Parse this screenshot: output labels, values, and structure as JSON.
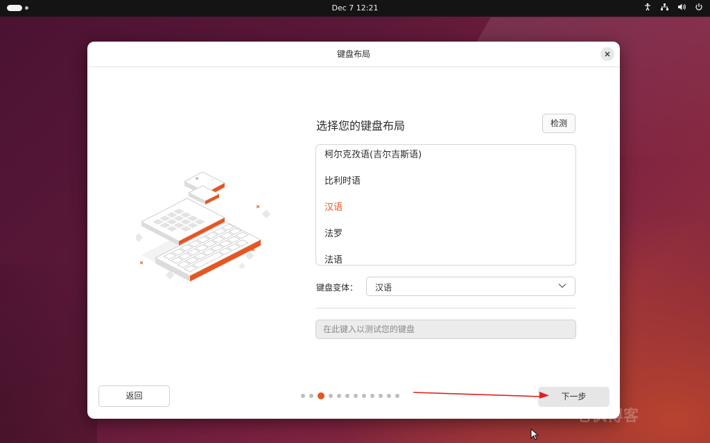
{
  "topbar": {
    "clock": "Dec 7  12:21",
    "tray_icons": [
      "accessibility-icon",
      "network-icon",
      "volume-icon",
      "power-icon"
    ]
  },
  "dialog": {
    "title": "键盘布局",
    "section_title": "选择您的键盘布局",
    "detect_label": "检测",
    "layouts": [
      {
        "label": "柯尔克孜语(吉尔吉斯语)",
        "selected": false
      },
      {
        "label": "比利时语",
        "selected": false
      },
      {
        "label": "汉语",
        "selected": true
      },
      {
        "label": "法罗",
        "selected": false
      },
      {
        "label": "法语",
        "selected": false
      }
    ],
    "variant_label": "键盘变体：",
    "variant_value": "汉语",
    "test_placeholder": "在此键入以测试您的键盘",
    "back_label": "返回",
    "next_label": "下一步",
    "pager": {
      "total": 12,
      "current": 3
    }
  },
  "colors": {
    "accent": "#e95420",
    "annotation_arrow": "#e02020"
  },
  "watermark": "老枫博客"
}
